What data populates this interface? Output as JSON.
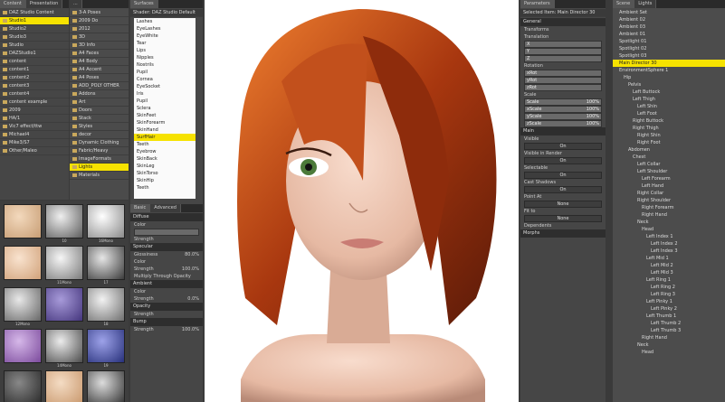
{
  "colors": {
    "selection": "#f6e200",
    "panel": "#464646",
    "viewport_bg": "#ffffff"
  },
  "content": {
    "tabs": [
      "Content",
      "Presentation",
      "..."
    ],
    "folders": [
      {
        "label": "DAZ Studio Content",
        "sel": false
      },
      {
        "label": "Studio1",
        "sel": true
      },
      {
        "label": "Studio2",
        "sel": false
      },
      {
        "label": "Studio3",
        "sel": false
      },
      {
        "label": "Studio",
        "sel": false
      },
      {
        "label": "DAZStudio1",
        "sel": false
      },
      {
        "label": "content",
        "sel": false
      },
      {
        "label": "content1",
        "sel": false
      },
      {
        "label": "content2",
        "sel": false
      },
      {
        "label": "content3",
        "sel": false
      },
      {
        "label": "content4",
        "sel": false
      },
      {
        "label": "content example",
        "sel": false
      },
      {
        "label": "2009",
        "sel": false
      },
      {
        "label": "HA/1",
        "sel": false
      },
      {
        "label": "Vic7 effect/ttw",
        "sel": false
      },
      {
        "label": "Michael4",
        "sel": false
      },
      {
        "label": "Mike3/S7",
        "sel": false
      },
      {
        "label": "Other/Maleo",
        "sel": false
      }
    ],
    "files": [
      {
        "label": "3-A Poses",
        "sel": false
      },
      {
        "label": "2009 Do",
        "sel": false
      },
      {
        "label": "2012",
        "sel": false
      },
      {
        "label": "3D",
        "sel": false
      },
      {
        "label": "3D Info",
        "sel": false
      },
      {
        "label": "A4 Faces",
        "sel": false
      },
      {
        "label": "A4 Body",
        "sel": false
      },
      {
        "label": "A4 Accent",
        "sel": false
      },
      {
        "label": "A4 Poses",
        "sel": false
      },
      {
        "label": "ADD_POLY OTHER",
        "sel": false
      },
      {
        "label": "Addons",
        "sel": false
      },
      {
        "label": "Art",
        "sel": false
      },
      {
        "label": "Doors",
        "sel": false
      },
      {
        "label": "Stack",
        "sel": false
      },
      {
        "label": "Styles",
        "sel": false
      },
      {
        "label": "decor",
        "sel": false
      },
      {
        "label": "Dynamic Clothing",
        "sel": false
      },
      {
        "label": "Fabric/Heavy",
        "sel": false
      },
      {
        "label": "ImageFormats",
        "sel": false
      },
      {
        "label": "Lights",
        "sel": true
      },
      {
        "label": "Materials",
        "sel": false
      }
    ],
    "swatches": [
      {
        "name": "",
        "colors": [
          "#f3d9bd",
          "#c79d74"
        ]
      },
      {
        "name": "10",
        "colors": [
          "#efefef",
          "#5c5c5c"
        ]
      },
      {
        "name": "16Mono",
        "colors": [
          "#ffffff",
          "#8a8a8a"
        ]
      },
      {
        "name": "",
        "colors": [
          "#f9e3cf",
          "#d1a27a"
        ]
      },
      {
        "name": "11Mono",
        "colors": [
          "#f6f6f6",
          "#7a7a7a"
        ]
      },
      {
        "name": "17",
        "colors": [
          "#e6e6e6",
          "#3a3a3a"
        ]
      },
      {
        "name": "12Mono",
        "colors": [
          "#e8e8e8",
          "#666"
        ]
      },
      {
        "name": "",
        "colors": [
          "#a79ad9",
          "#44357c"
        ]
      },
      {
        "name": "18",
        "colors": [
          "#f2f2f2",
          "#6e6e6e"
        ]
      },
      {
        "name": "",
        "colors": [
          "#d6b8e9",
          "#7b4a9c"
        ]
      },
      {
        "name": "14Mono",
        "colors": [
          "#ececec",
          "#4b4b4b"
        ]
      },
      {
        "name": "19",
        "colors": [
          "#9da2e9",
          "#27307a"
        ]
      },
      {
        "name": "",
        "colors": [
          "#888",
          "#2a2a2a"
        ]
      },
      {
        "name": "",
        "colors": [
          "#f4dcc4",
          "#c9986d"
        ]
      },
      {
        "name": "",
        "colors": [
          "#dcdcdc",
          "#333"
        ]
      }
    ]
  },
  "surfaces": {
    "title": "Surfaces",
    "header": "Shader: DAZ Studio Default",
    "items": [
      {
        "label": "Lashes",
        "sel": false
      },
      {
        "label": "EyeLashes",
        "sel": false
      },
      {
        "label": "EyeWhite",
        "sel": false
      },
      {
        "label": "Tear",
        "sel": false
      },
      {
        "label": "Lips",
        "sel": false
      },
      {
        "label": "Nipples",
        "sel": false
      },
      {
        "label": "Nostrils",
        "sel": false
      },
      {
        "label": "Pupil",
        "sel": false
      },
      {
        "label": "Cornea",
        "sel": false
      },
      {
        "label": "EyeSocket",
        "sel": false
      },
      {
        "label": "Iris",
        "sel": false
      },
      {
        "label": "Pupil",
        "sel": false
      },
      {
        "label": "Sclera",
        "sel": false
      },
      {
        "label": "SkinFeet",
        "sel": false
      },
      {
        "label": "SkinForearm",
        "sel": false
      },
      {
        "label": "SkinHand",
        "sel": false
      },
      {
        "label": "SurfHair",
        "sel": true
      },
      {
        "label": "Teeth",
        "sel": false
      },
      {
        "label": "Eyebrow",
        "sel": false
      },
      {
        "label": "SkinBack",
        "sel": false
      },
      {
        "label": "SkinLeg",
        "sel": false
      },
      {
        "label": "SkinTorso",
        "sel": false
      },
      {
        "label": "SkinHip",
        "sel": false
      },
      {
        "label": "Teeth",
        "sel": false
      }
    ],
    "tabs": [
      "Basic",
      "Advanced"
    ],
    "props": [
      {
        "type": "sec",
        "label": "Diffuse"
      },
      {
        "type": "lbl",
        "label": "Color"
      },
      {
        "type": "field",
        "label": "",
        "value": ""
      },
      {
        "type": "lbl",
        "label": "Strength"
      },
      {
        "type": "sec",
        "label": "Specular"
      },
      {
        "type": "lbl",
        "label": "Glossiness",
        "value": "80.0%"
      },
      {
        "type": "lbl",
        "label": "Color"
      },
      {
        "type": "lbl",
        "label": "Strength",
        "value": "100.0%"
      },
      {
        "type": "lbl",
        "label": "Multiply Through Opacity"
      },
      {
        "type": "sec",
        "label": "Ambient"
      },
      {
        "type": "lbl",
        "label": "Color"
      },
      {
        "type": "lbl",
        "label": "Strength",
        "value": "0.0%"
      },
      {
        "type": "sec",
        "label": "Opacity"
      },
      {
        "type": "lbl",
        "label": "Strength"
      },
      {
        "type": "sec",
        "label": "Bump"
      },
      {
        "type": "lbl",
        "label": "Strength",
        "value": "100.0%"
      }
    ]
  },
  "params": {
    "title": "Parameters",
    "header": "Selected Item:  Main Director 30",
    "items": [
      {
        "type": "sec",
        "label": "General"
      },
      {
        "type": "lbl",
        "label": "Transforms"
      },
      {
        "type": "lbl",
        "label": "Translation"
      },
      {
        "type": "field",
        "label": "X",
        "value": ""
      },
      {
        "type": "field",
        "label": "Y",
        "value": ""
      },
      {
        "type": "field",
        "label": "Z",
        "value": ""
      },
      {
        "type": "lbl",
        "label": "Rotation"
      },
      {
        "type": "field",
        "label": "xRot",
        "value": ""
      },
      {
        "type": "field",
        "label": "yRot",
        "value": ""
      },
      {
        "type": "field",
        "label": "zRot",
        "value": ""
      },
      {
        "type": "lbl",
        "label": "Scale"
      },
      {
        "type": "field",
        "label": "Scale",
        "value": "100%"
      },
      {
        "type": "field",
        "label": "xScale",
        "value": "100%"
      },
      {
        "type": "field",
        "label": "yScale",
        "value": "100%"
      },
      {
        "type": "field",
        "label": "zScale",
        "value": "100%"
      },
      {
        "type": "sec",
        "label": "Main"
      },
      {
        "type": "lbl",
        "label": "Visible"
      },
      {
        "type": "btn",
        "label": "On"
      },
      {
        "type": "lbl",
        "label": "Visible in Render"
      },
      {
        "type": "btn",
        "label": "On"
      },
      {
        "type": "lbl",
        "label": "Selectable"
      },
      {
        "type": "btn",
        "label": "On"
      },
      {
        "type": "lbl",
        "label": "Cast Shadows"
      },
      {
        "type": "btn",
        "label": "On"
      },
      {
        "type": "lbl",
        "label": "Point At"
      },
      {
        "type": "btn",
        "label": "None"
      },
      {
        "type": "lbl",
        "label": "Fit to"
      },
      {
        "type": "btn",
        "label": "None"
      },
      {
        "type": "lbl",
        "label": "Dependents"
      },
      {
        "type": "sec",
        "label": "Morphs"
      }
    ]
  },
  "scene": {
    "title": "Scene",
    "tabs": [
      "Scene",
      "Lights"
    ],
    "items": [
      {
        "label": "Ambient Set",
        "depth": 1,
        "sel": false
      },
      {
        "label": "Ambient 02",
        "depth": 1,
        "sel": false
      },
      {
        "label": "Ambient 03",
        "depth": 1,
        "sel": false
      },
      {
        "label": "Ambient 01",
        "depth": 1,
        "sel": false
      },
      {
        "label": "Spotlight 01",
        "depth": 1,
        "sel": false
      },
      {
        "label": "Spotlight 02",
        "depth": 1,
        "sel": false
      },
      {
        "label": "Spotlight 03",
        "depth": 1,
        "sel": false
      },
      {
        "label": "Main Director 30",
        "depth": 1,
        "sel": true
      },
      {
        "label": "EnvironmentSphere 1",
        "depth": 1,
        "sel": false
      },
      {
        "label": "Hip",
        "depth": 2,
        "sel": false
      },
      {
        "label": "Pelvis",
        "depth": 3,
        "sel": false
      },
      {
        "label": "Left Buttock",
        "depth": 4,
        "sel": false
      },
      {
        "label": "Left Thigh",
        "depth": 4,
        "sel": false
      },
      {
        "label": "Left Shin",
        "depth": 5,
        "sel": false
      },
      {
        "label": "Left Foot",
        "depth": 5,
        "sel": false
      },
      {
        "label": "Right Buttock",
        "depth": 4,
        "sel": false
      },
      {
        "label": "Right Thigh",
        "depth": 4,
        "sel": false
      },
      {
        "label": "Right Shin",
        "depth": 5,
        "sel": false
      },
      {
        "label": "Right Foot",
        "depth": 5,
        "sel": false
      },
      {
        "label": "Abdomen",
        "depth": 3,
        "sel": false
      },
      {
        "label": "Chest",
        "depth": 4,
        "sel": false
      },
      {
        "label": "Left Collar",
        "depth": 5,
        "sel": false
      },
      {
        "label": "Left Shoulder",
        "depth": 5,
        "sel": false
      },
      {
        "label": "Left Forearm",
        "depth": 6,
        "sel": false
      },
      {
        "label": "Left Hand",
        "depth": 6,
        "sel": false
      },
      {
        "label": "Right Collar",
        "depth": 5,
        "sel": false
      },
      {
        "label": "Right Shoulder",
        "depth": 5,
        "sel": false
      },
      {
        "label": "Right Forearm",
        "depth": 6,
        "sel": false
      },
      {
        "label": "Right Hand",
        "depth": 6,
        "sel": false
      },
      {
        "label": "Neck",
        "depth": 5,
        "sel": false
      },
      {
        "label": "Head",
        "depth": 6,
        "sel": false
      },
      {
        "label": "Left Index 1",
        "depth": 7,
        "sel": false
      },
      {
        "label": "Left Index 2",
        "depth": 8,
        "sel": false
      },
      {
        "label": "Left Index 3",
        "depth": 8,
        "sel": false
      },
      {
        "label": "Left Mid 1",
        "depth": 7,
        "sel": false
      },
      {
        "label": "Left Mid 2",
        "depth": 8,
        "sel": false
      },
      {
        "label": "Left Mid 3",
        "depth": 8,
        "sel": false
      },
      {
        "label": "Left Ring 1",
        "depth": 7,
        "sel": false
      },
      {
        "label": "Left Ring 2",
        "depth": 8,
        "sel": false
      },
      {
        "label": "Left Ring 3",
        "depth": 8,
        "sel": false
      },
      {
        "label": "Left Pinky 1",
        "depth": 7,
        "sel": false
      },
      {
        "label": "Left Pinky 2",
        "depth": 8,
        "sel": false
      },
      {
        "label": "Left Thumb 1",
        "depth": 7,
        "sel": false
      },
      {
        "label": "Left Thumb 2",
        "depth": 8,
        "sel": false
      },
      {
        "label": "Left Thumb 3",
        "depth": 8,
        "sel": false
      },
      {
        "label": "Right Hand",
        "depth": 6,
        "sel": false
      },
      {
        "label": "Neck",
        "depth": 5,
        "sel": false
      },
      {
        "label": "Head",
        "depth": 6,
        "sel": false
      }
    ]
  }
}
